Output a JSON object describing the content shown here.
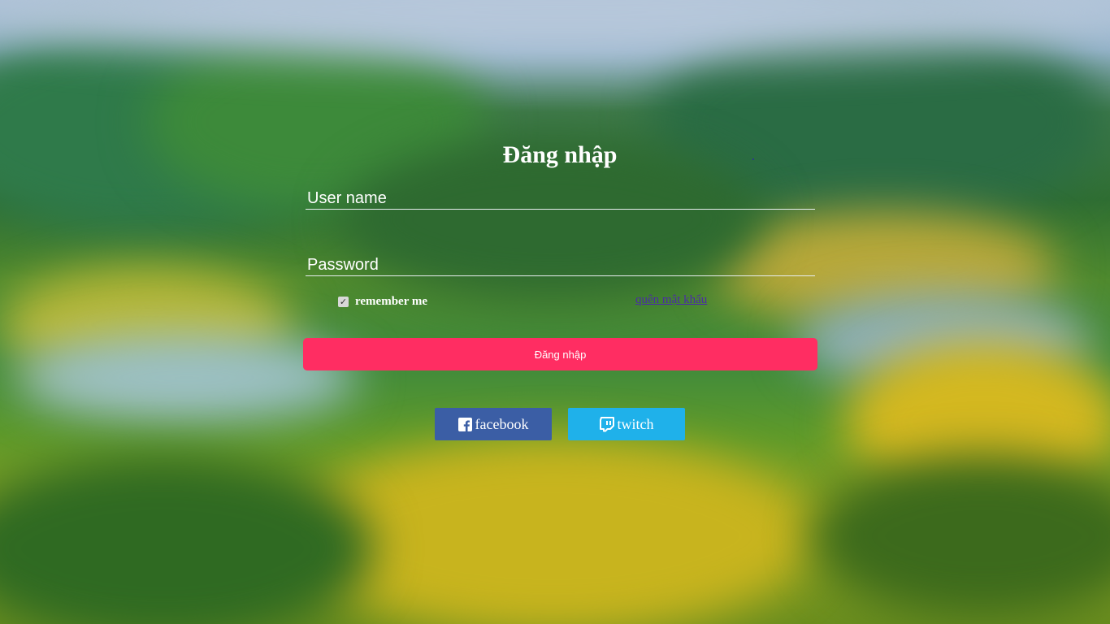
{
  "login": {
    "title": "Đăng nhập",
    "username_placeholder": "User name",
    "password_placeholder": "Password",
    "remember_label": "remember me",
    "remember_checked": true,
    "forgot_link": "quên mật khẩu",
    "submit_label": "Đăng nhập"
  },
  "social": {
    "facebook": {
      "label": "facebook",
      "icon": "facebook-icon",
      "color": "#3b5ea5"
    },
    "twitch": {
      "label": "twitch",
      "icon": "twitch-icon",
      "color": "#1fb1ea"
    }
  },
  "colors": {
    "accent": "#ff2d62",
    "link": "#4b2aa8"
  }
}
